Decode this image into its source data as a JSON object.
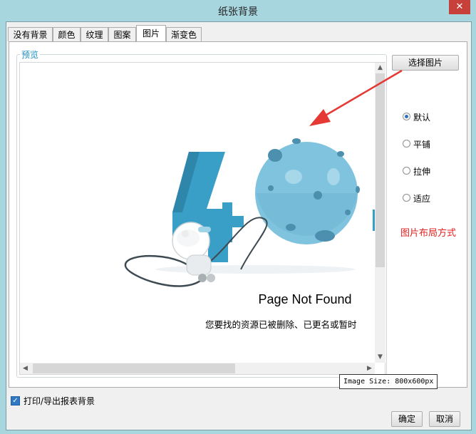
{
  "window": {
    "title": "纸张背景",
    "close_glyph": "✕"
  },
  "tabs": [
    {
      "label": "没有背景",
      "active": false
    },
    {
      "label": "颜色",
      "active": false
    },
    {
      "label": "纹理",
      "active": false
    },
    {
      "label": "图案",
      "active": false
    },
    {
      "label": "图片",
      "active": true
    },
    {
      "label": "渐变色",
      "active": false
    }
  ],
  "preview": {
    "group_label": "预览",
    "image": {
      "headline": "Page Not Found",
      "subtext": "您要找的资源已被删除、已更名或暂时",
      "illustration": "404 astronaut planet",
      "colors": {
        "digit": "#3a9fc7",
        "planet": "#7fc3de",
        "planet_dark": "#4d8fae"
      }
    },
    "size_tooltip": "Image Size: 800x600px",
    "scroll": {
      "up": "▲",
      "down": "▼",
      "left": "◀",
      "right": "▶"
    }
  },
  "select_button": {
    "label": "选择图片"
  },
  "layout_options": {
    "items": [
      {
        "label": "默认",
        "checked": true
      },
      {
        "label": "平铺",
        "checked": false
      },
      {
        "label": "拉伸",
        "checked": false
      },
      {
        "label": "适应",
        "checked": false
      }
    ]
  },
  "annotation": {
    "text": "图片布局方式",
    "color": "#e02020",
    "arrow_color": "#e53935"
  },
  "print_export": {
    "label": "打印/导出报表背景",
    "checked": true,
    "check_glyph": "✓"
  },
  "buttons": {
    "ok": "确定",
    "cancel": "取消"
  }
}
